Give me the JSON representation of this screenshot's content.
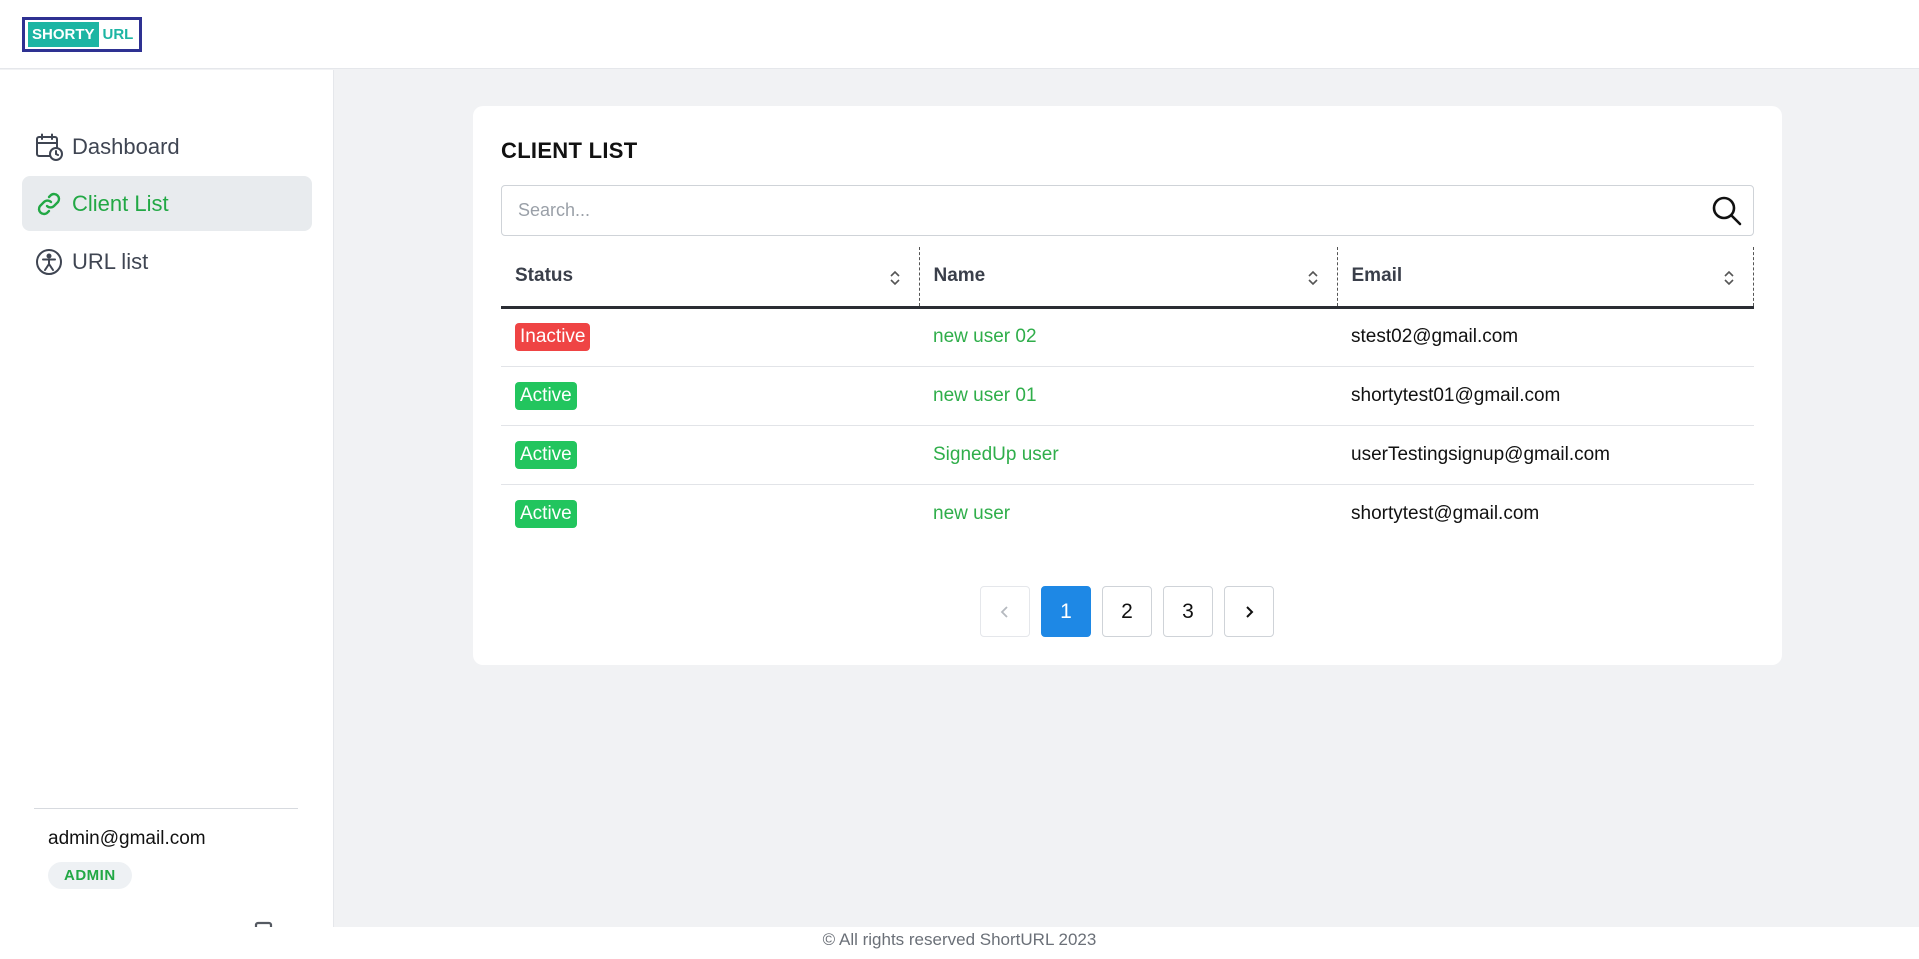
{
  "brand": {
    "part1": "SHORTY",
    "part2": "URL"
  },
  "sidebar": {
    "items": [
      {
        "label": "Dashboard",
        "icon": "calendar-clock-icon"
      },
      {
        "label": "Client List",
        "icon": "link-icon",
        "active": true
      },
      {
        "label": "URL list",
        "icon": "accessibility-icon"
      }
    ],
    "user": {
      "email": "admin@gmail.com",
      "role": "ADMIN"
    }
  },
  "main": {
    "title": "CLIENT LIST",
    "search": {
      "placeholder": "Search...",
      "value": ""
    },
    "table": {
      "columns": [
        "Status",
        "Name",
        "Email"
      ],
      "rows": [
        {
          "status": "Inactive",
          "name": "new user 02",
          "email": "stest02@gmail.com"
        },
        {
          "status": "Active",
          "name": "new user 01",
          "email": "shortytest01@gmail.com"
        },
        {
          "status": "Active",
          "name": "SignedUp user",
          "email": "userTestingsignup@gmail.com"
        },
        {
          "status": "Active",
          "name": "new user",
          "email": "shortytest@gmail.com"
        }
      ]
    },
    "pagination": {
      "pages": [
        "1",
        "2",
        "3"
      ],
      "current": "1"
    }
  },
  "footer": {
    "text": "© All rights reserved ShortURL 2023"
  },
  "colors": {
    "accent_green": "#22a845",
    "inactive": "#ef4444",
    "active": "#22c55e",
    "page_current": "#1e88e5"
  }
}
